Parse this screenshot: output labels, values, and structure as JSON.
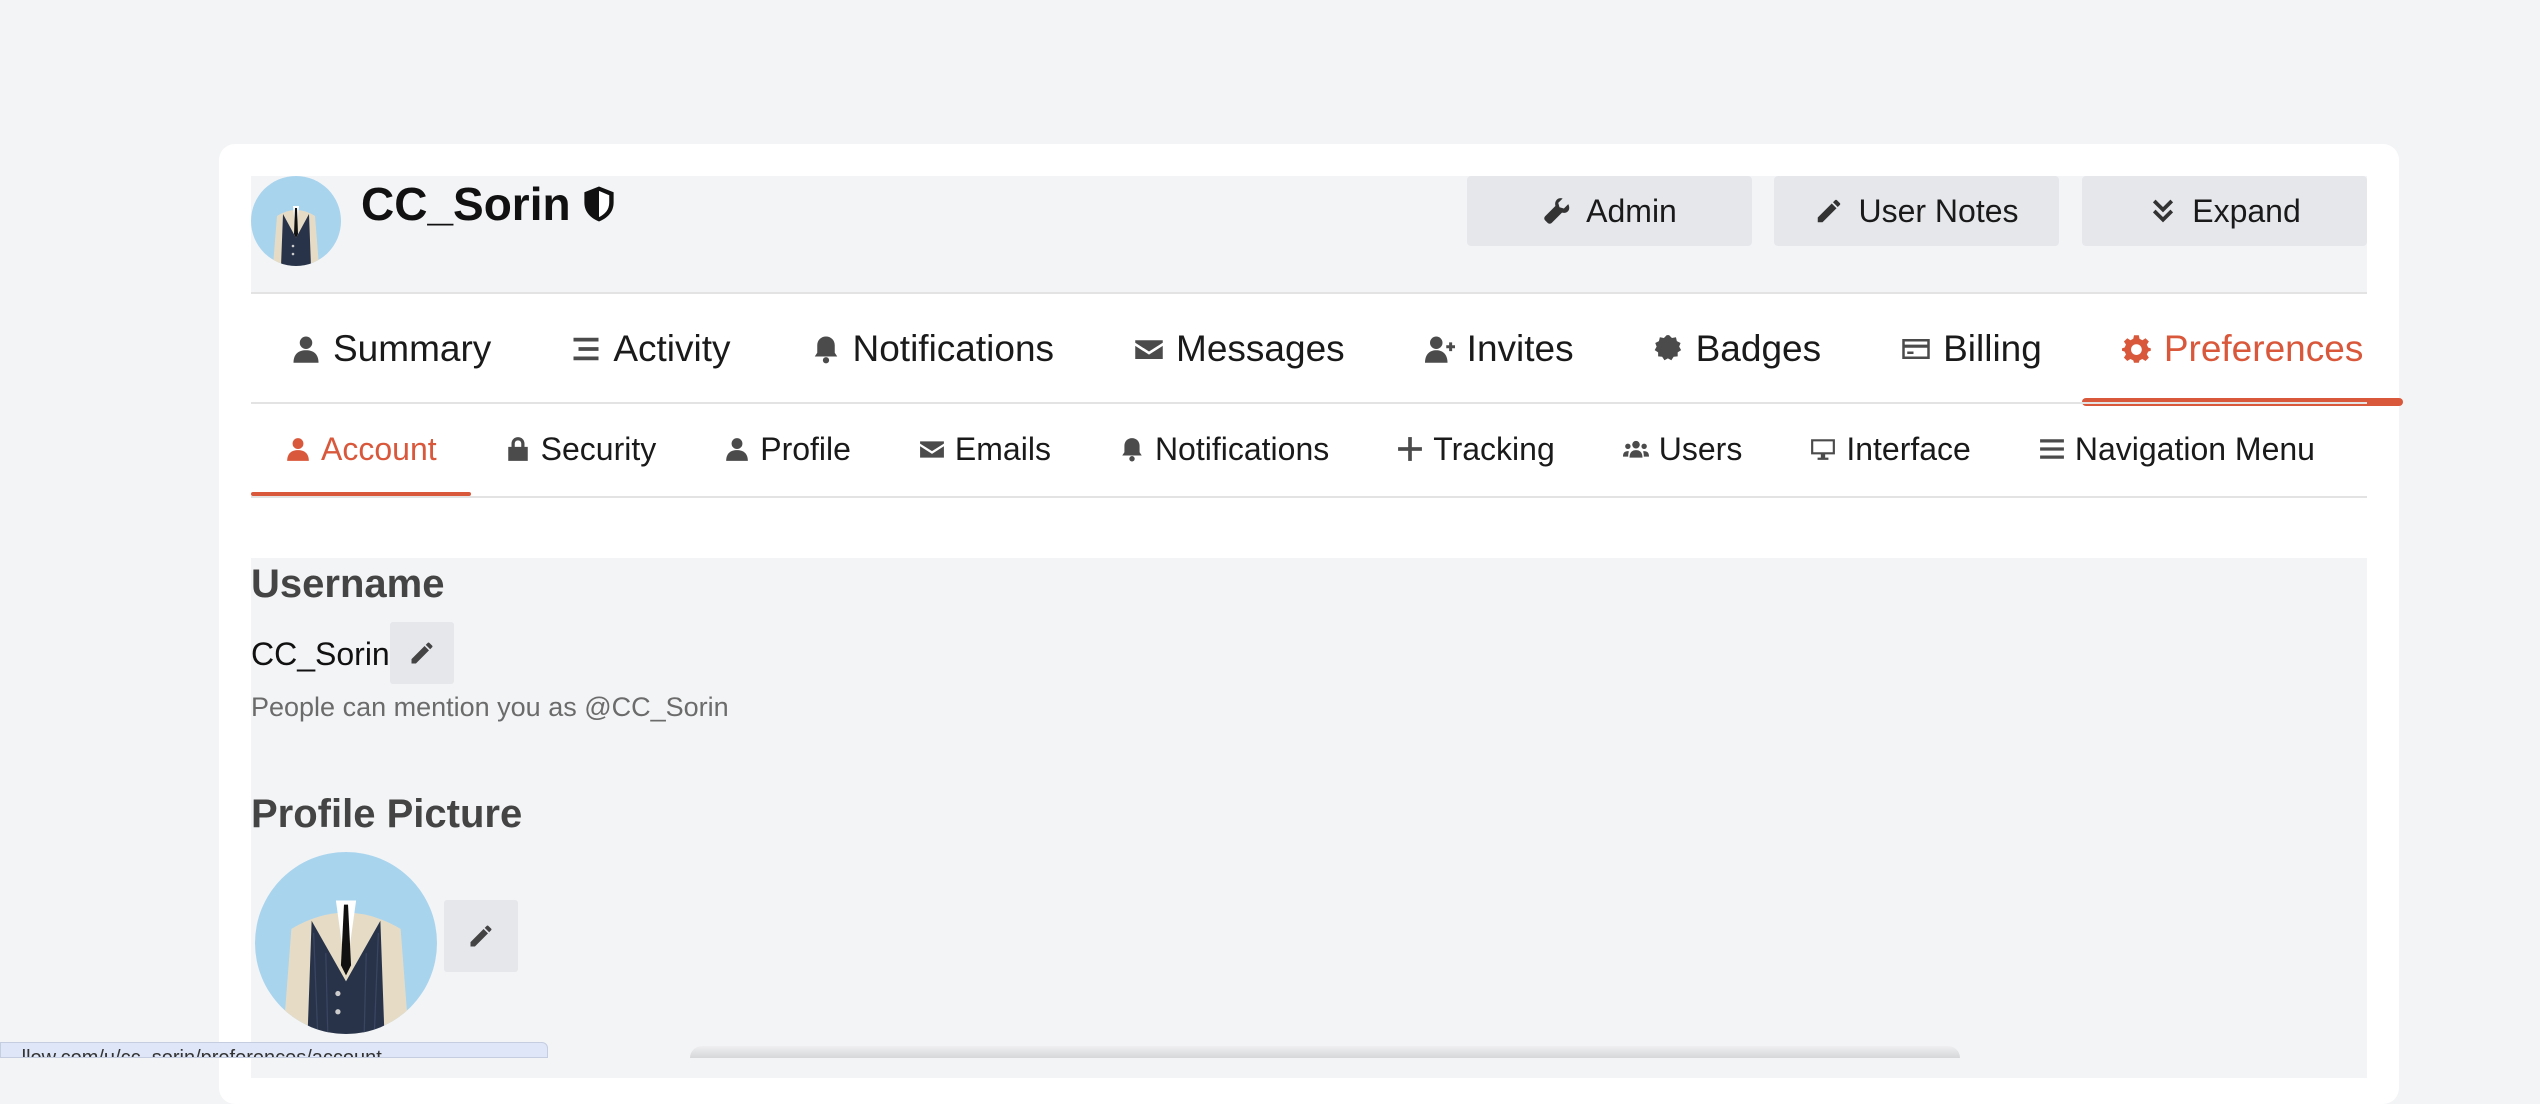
{
  "user": {
    "name": "CC_Sorin",
    "badge_icon": "shield-icon"
  },
  "header_buttons": [
    {
      "label": "Admin",
      "icon": "wrench-icon"
    },
    {
      "label": "User Notes",
      "icon": "pencil-icon"
    },
    {
      "label": "Expand",
      "icon": "chevrons-down-icon"
    }
  ],
  "main_tabs": [
    {
      "label": "Summary",
      "icon": "user-icon"
    },
    {
      "label": "Activity",
      "icon": "list-icon"
    },
    {
      "label": "Notifications",
      "icon": "bell-icon"
    },
    {
      "label": "Messages",
      "icon": "envelope-icon"
    },
    {
      "label": "Invites",
      "icon": "user-plus-icon"
    },
    {
      "label": "Badges",
      "icon": "certificate-icon"
    },
    {
      "label": "Billing",
      "icon": "credit-card-icon"
    },
    {
      "label": "Preferences",
      "icon": "gear-icon",
      "active": true
    }
  ],
  "sub_tabs": [
    {
      "label": "Account",
      "icon": "user-icon",
      "active": true
    },
    {
      "label": "Security",
      "icon": "lock-icon"
    },
    {
      "label": "Profile",
      "icon": "user-icon"
    },
    {
      "label": "Emails",
      "icon": "envelope-icon"
    },
    {
      "label": "Notifications",
      "icon": "bell-icon"
    },
    {
      "label": "Tracking",
      "icon": "plus-icon"
    },
    {
      "label": "Users",
      "icon": "users-icon"
    },
    {
      "label": "Interface",
      "icon": "desktop-icon"
    },
    {
      "label": "Navigation Menu",
      "icon": "bars-icon"
    }
  ],
  "account": {
    "username_heading": "Username",
    "username_value": "CC_Sorin",
    "mention_text": "People can mention you as @CC_Sorin",
    "profile_picture_heading": "Profile Picture"
  },
  "status_bar": {
    "url": "...llow.com/u/cc_sorin/preferences/account"
  },
  "colors": {
    "accent": "#d9583b",
    "page_bg": "#f3f4f6",
    "button_bg": "#e5e7eb"
  }
}
